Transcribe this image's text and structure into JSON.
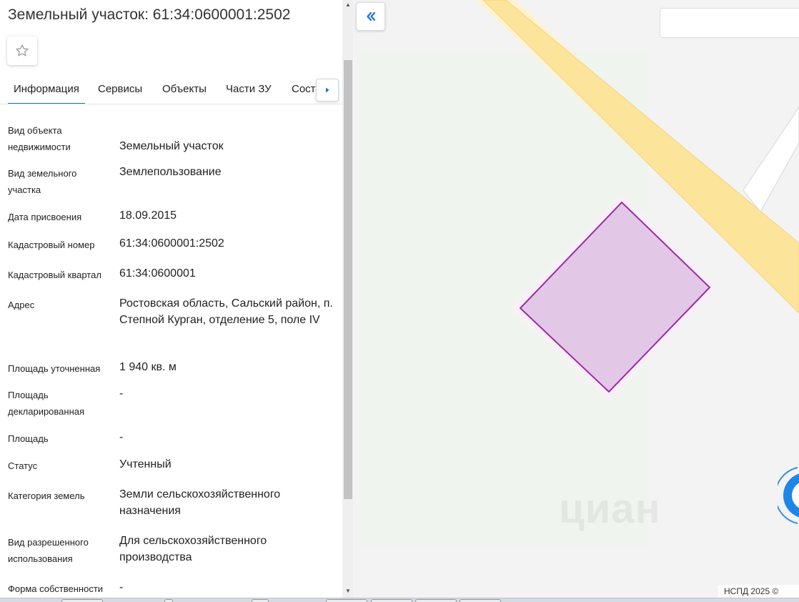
{
  "panel": {
    "title": "Земельный участок: 61:34:0600001:2502",
    "favorite_icon": "star-outline-icon",
    "tabs": [
      {
        "label": "Информация",
        "active": true
      },
      {
        "label": "Сервисы",
        "active": false
      },
      {
        "label": "Объекты",
        "active": false
      },
      {
        "label": "Части ЗУ",
        "active": false
      },
      {
        "label": "Соста",
        "active": false
      }
    ],
    "tabs_next_icon": "caret-right-icon",
    "rows": [
      {
        "label": "Вид объекта недвижимости",
        "value": "Земельный участок"
      },
      {
        "label": "Вид земельного участка",
        "value": "Землепользование"
      },
      {
        "label": "Дата присвоения",
        "value": "18.09.2015"
      },
      {
        "label": "Кадастровый номер",
        "value": "61:34:0600001:2502"
      },
      {
        "label": "Кадастровый квартал",
        "value": "61:34:0600001"
      },
      {
        "label": "Адрес",
        "value": "Ростовская область, Сальский район, п. Степной Курган, отделение 5, поле IV"
      },
      {
        "label": "Площадь уточненная",
        "value": "1 940 кв. м"
      },
      {
        "label": "Площадь декларированная",
        "value": "-"
      },
      {
        "label": "Площадь",
        "value": "-"
      },
      {
        "label": "Статус",
        "value": "Учтенный"
      },
      {
        "label": "Категория земель",
        "value": "Земли сельскохозяйственного назначения"
      },
      {
        "label": "Вид разрешенного использования",
        "value": "Для сельскохозяйственного производства"
      },
      {
        "label": "Форма собственности",
        "value": "-"
      }
    ]
  },
  "map": {
    "collapse_icon": "double-chevron-left-icon",
    "search_value": "",
    "watermark": "циан",
    "attribution": "НСПД 2025 ©",
    "chat_icon": "chat-bubble-icon",
    "colors": {
      "background": "#f3f3f3",
      "road": "#fde49b",
      "parcel_fill": "#e3c7e6",
      "parcel_stroke": "#9c2aa8",
      "accent": "#1a73c9"
    }
  }
}
